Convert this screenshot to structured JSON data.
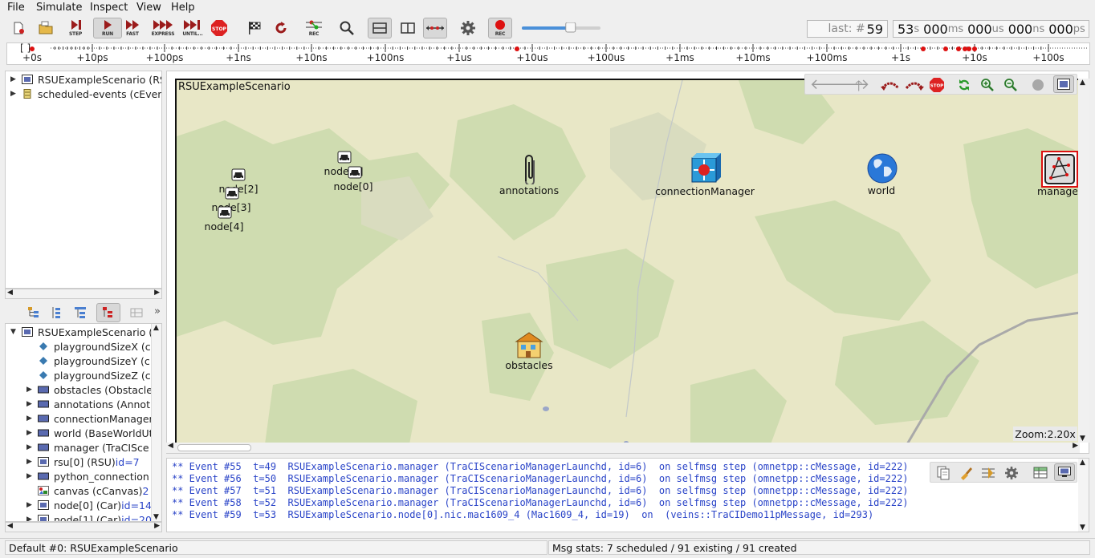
{
  "menu": [
    "File",
    "Simulate",
    "Inspect",
    "View",
    "Help"
  ],
  "toolbar": {
    "step": "STEP",
    "run": "RUN",
    "fast": "FAST",
    "express": "EXPRESS",
    "until": "UNTIL...",
    "stop": "STOP",
    "rec": "REC",
    "rec2": "REC",
    "speed_fraction": 0.62
  },
  "event_counter": {
    "prefix": "last: #",
    "value": "59"
  },
  "sim_time": {
    "s": "53",
    "ms": "000",
    "us": "000",
    "ns": "000",
    "ps": "000",
    "u_s": "s",
    "u_ms": "ms",
    "u_us": "us",
    "u_ns": "ns",
    "u_ps": "ps"
  },
  "timeline": {
    "bracket": "[ ]",
    "labels": [
      "+0s",
      "+10ps",
      "+100ps",
      "+1ns",
      "+10ns",
      "+100ns",
      "+1us",
      "+10us",
      "+100us",
      "+1ms",
      "+10ms",
      "+100ms",
      "+1s",
      "+10s",
      "+100s"
    ]
  },
  "object_tree": [
    {
      "label": "RSUExampleScenario (RS",
      "icon": "network-icon"
    },
    {
      "label": "scheduled-events (cEven",
      "icon": "queue-icon"
    }
  ],
  "inspector_tree": [
    {
      "label": "RSUExampleScenario (",
      "extra": "",
      "icon": "network-icon",
      "expandable": true,
      "expanded": true,
      "indent": 0
    },
    {
      "label": "playgroundSizeX (c",
      "extra": "",
      "icon": "param-icon",
      "expandable": false,
      "indent": 1
    },
    {
      "label": "playgroundSizeY (c",
      "extra": "",
      "icon": "param-icon",
      "expandable": false,
      "indent": 1
    },
    {
      "label": "playgroundSizeZ (c",
      "extra": "",
      "icon": "param-icon",
      "expandable": false,
      "indent": 1
    },
    {
      "label": "obstacles (Obstacle",
      "extra": "",
      "icon": "module-icon",
      "expandable": true,
      "indent": 1
    },
    {
      "label": "annotations (Annot",
      "extra": "",
      "icon": "module-icon",
      "expandable": true,
      "indent": 1
    },
    {
      "label": "connectionManager",
      "extra": "",
      "icon": "module-icon",
      "expandable": true,
      "indent": 1
    },
    {
      "label": "world (BaseWorldUt",
      "extra": "",
      "icon": "module-icon",
      "expandable": true,
      "indent": 1
    },
    {
      "label": "manager (TraCISce",
      "extra": "",
      "icon": "module-icon",
      "expandable": true,
      "indent": 1
    },
    {
      "label": "rsu[0] (RSU) ",
      "extra": "id=7",
      "icon": "network-icon",
      "expandable": true,
      "indent": 1
    },
    {
      "label": "python_connection",
      "extra": "",
      "icon": "module-icon",
      "expandable": true,
      "indent": 1
    },
    {
      "label": "canvas (cCanvas) ",
      "extra": "2",
      "icon": "canvas-icon",
      "expandable": false,
      "indent": 1
    },
    {
      "label": "node[0] (Car) ",
      "extra": "id=14",
      "icon": "network-icon",
      "expandable": true,
      "indent": 1
    },
    {
      "label": "node[1] (Car) ",
      "extra": "id=20",
      "icon": "network-icon",
      "expandable": true,
      "indent": 1
    }
  ],
  "canvas": {
    "title": "RSUExampleScenario",
    "zoom": "Zoom:2.20x",
    "modules": [
      {
        "name": "node[2]",
        "icon": "car-icon"
      },
      {
        "name": "node[1]",
        "icon": "car-icon"
      },
      {
        "name": "node[0]",
        "icon": "car-icon"
      },
      {
        "name": "node[3]",
        "icon": "car-icon"
      },
      {
        "name": "node[4]",
        "icon": "car-icon"
      },
      {
        "name": "annotations",
        "icon": "paperclip-icon"
      },
      {
        "name": "connectionManager",
        "icon": "switch-icon"
      },
      {
        "name": "world",
        "icon": "globe-icon"
      },
      {
        "name": "manager",
        "icon": "manager-icon"
      },
      {
        "name": "obstacles",
        "icon": "house-icon"
      }
    ]
  },
  "log": [
    "** Event #55  t=49  RSUExampleScenario.manager (TraCIScenarioManagerLaunchd, id=6)  on selfmsg step (omnetpp::cMessage, id=222)",
    "** Event #56  t=50  RSUExampleScenario.manager (TraCIScenarioManagerLaunchd, id=6)  on selfmsg step (omnetpp::cMessage, id=222)",
    "** Event #57  t=51  RSUExampleScenario.manager (TraCIScenarioManagerLaunchd, id=6)  on selfmsg step (omnetpp::cMessage, id=222)",
    "** Event #58  t=52  RSUExampleScenario.manager (TraCIScenarioManagerLaunchd, id=6)  on selfmsg step (omnetpp::cMessage, id=222)",
    "** Event #59  t=53  RSUExampleScenario.node[0].nic.mac1609_4 (Mac1609_4, id=19)  on  (veins::TraCIDemo11pMessage, id=293)"
  ],
  "status": {
    "left": "Default #0: RSUExampleScenario",
    "right": "Msg stats: 7 scheduled / 91 existing / 91 created"
  },
  "colors": {
    "accent": "#cc2020",
    "log_text": "#2a44c8",
    "map_bg": "#e8e7c6"
  }
}
